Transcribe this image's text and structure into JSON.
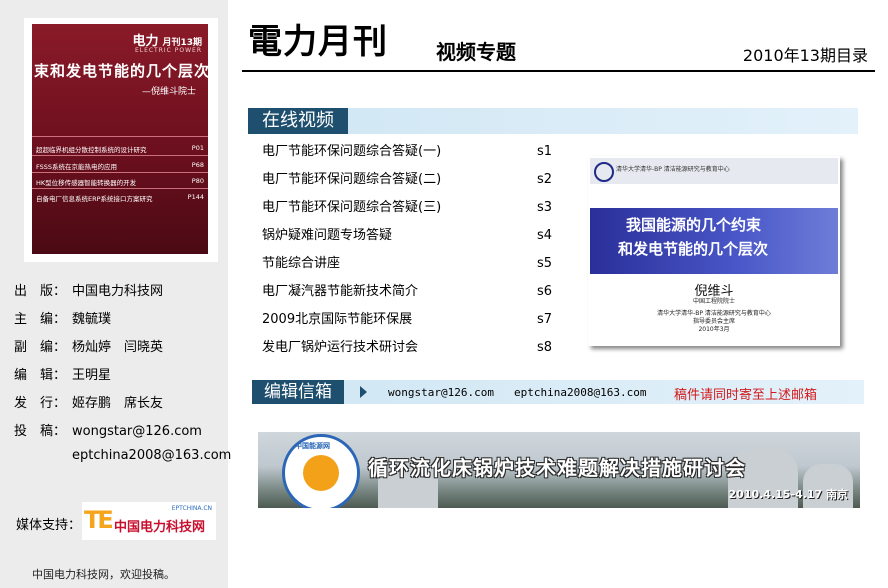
{
  "cover": {
    "brand": "电力",
    "issue_badge": "月刊13期",
    "brand_en": "ELECTRIC POWER",
    "headline": "束和发电节能的几个层次",
    "author": "—倪维斗院士",
    "toc": [
      {
        "title": "超超临界机组分散控制系统的设计研究",
        "page": "P01"
      },
      {
        "title": "FSSS系统在京能热电的应用",
        "page": "P68"
      },
      {
        "title": "HK型位移传感器智能转换器的开发",
        "page": "P80"
      },
      {
        "title": "自备电厂信息系统ERP系统接口方案研究",
        "page": "P144"
      }
    ]
  },
  "meta": [
    {
      "key": "出　版：",
      "value": "中国电力科技网"
    },
    {
      "key": "主　编：",
      "value": "魏毓璞"
    },
    {
      "key": "副　编：",
      "value": "杨灿婷　闫晓英"
    },
    {
      "key": "编　辑：",
      "value": "王明星"
    },
    {
      "key": "发　行：",
      "value": "姬存鹏　席长友"
    },
    {
      "key": "投　稿：",
      "value": "wongstar@126.com"
    }
  ],
  "meta_extra_email": "eptchina2008@163.com",
  "media": {
    "label": "媒体支持：",
    "logo_mark": "TE",
    "logo_name": "中国电力科技网",
    "logo_url": "EPTCHINA.CN"
  },
  "footer_note": "中国电力科技网，欢迎投稿。",
  "header": {
    "title": "電力月刊",
    "subtitle": "视频专题",
    "issue": "2010年13期目录"
  },
  "online_video": {
    "title": "在线视频",
    "items": [
      {
        "label": "电厂节能环保问题综合答疑(一)",
        "code": "s1"
      },
      {
        "label": "电厂节能环保问题综合答疑(二)",
        "code": "s2"
      },
      {
        "label": "电厂节能环保问题综合答疑(三)",
        "code": "s3"
      },
      {
        "label": "锅炉疑难问题专场答疑",
        "code": "s4"
      },
      {
        "label": "节能综合讲座",
        "code": "s5"
      },
      {
        "label": "电厂凝汽器节能新技术简介",
        "code": "s6"
      },
      {
        "label": "2009北京国际节能环保展",
        "code": "s7"
      },
      {
        "label": "发电厂锅炉运行技术研讨会",
        "code": "s8"
      }
    ]
  },
  "slide": {
    "header": "清华大学清华-BP 清洁能源研究与教育中心",
    "line1": "我国能源的几个约束",
    "line2": "和发电节能的几个层次",
    "author": "倪维斗",
    "author_title": "中国工程院院士",
    "org1": "清华大学清华-BP 清洁能源研究与教育中心",
    "org2": "指导委员会主席",
    "date": "2010年3月"
  },
  "mailbox": {
    "title": "编辑信箱",
    "email1": "wongstar@126.com",
    "email2": "eptchina2008@163.com",
    "note": "稿件请同时寄至上述邮箱"
  },
  "banner": {
    "badge_text": "中国能源网",
    "title": "循环流化床锅炉技术难题解决措施研讨会",
    "date": "2010.4.15-4.17 南京"
  }
}
